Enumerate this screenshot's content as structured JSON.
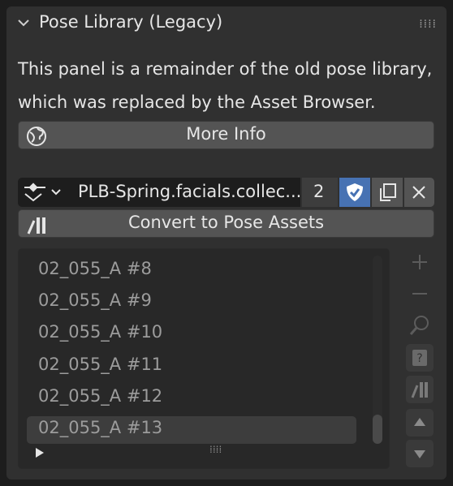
{
  "panel": {
    "title": "Pose Library (Legacy)",
    "description_line1": "This panel is a remainder of the old pose library,",
    "description_line2": "which was replaced by the Asset Browser.",
    "more_info_label": "More Info",
    "convert_label": "Convert to Pose Assets"
  },
  "library": {
    "name": "PLB-Spring.facials.collec...",
    "users": "2"
  },
  "poses": {
    "items": [
      "02_055_A #8",
      "02_055_A #9",
      "02_055_A #10",
      "02_055_A #11",
      "02_055_A #12",
      "02_055_A #13"
    ],
    "active_index": 5
  },
  "colors": {
    "panel_bg": "#303030",
    "button_bg": "#545454",
    "active_blue": "#4772b3",
    "list_bg": "#282828"
  }
}
